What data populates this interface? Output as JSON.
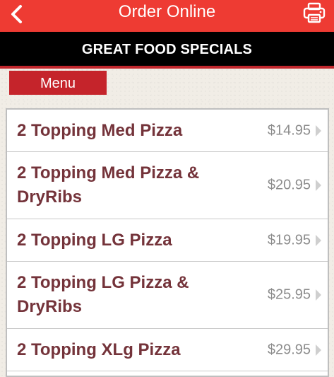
{
  "header": {
    "title": "Order Online",
    "back_icon": "chevron-left-icon",
    "print_icon": "printer-icon",
    "bar_color": "#ee3b33"
  },
  "banner": {
    "text": "GREAT FOOD SPECIALS"
  },
  "menu_tab": {
    "label": "Menu",
    "color": "#c5242b"
  },
  "items": [
    {
      "name": "2 Topping Med Pizza",
      "price": "$14.95"
    },
    {
      "name": "2 Topping Med Pizza & DryRibs",
      "price": "$20.95"
    },
    {
      "name": "2 Topping LG Pizza",
      "price": "$19.95"
    },
    {
      "name": "2 Topping LG Pizza & DryRibs",
      "price": "$25.95"
    },
    {
      "name": "2 Topping XLg Pizza",
      "price": "$29.95"
    }
  ],
  "colors": {
    "item_text": "#74333a",
    "price_text": "#8c8c8c"
  }
}
